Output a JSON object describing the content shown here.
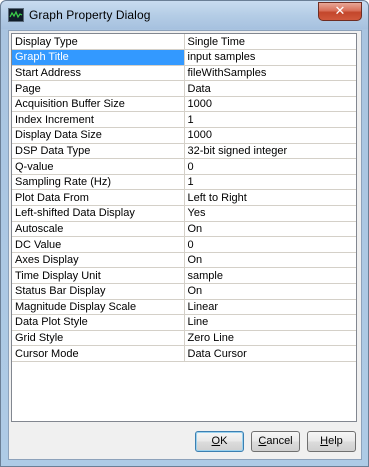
{
  "window": {
    "title": "Graph Property Dialog",
    "close_glyph": "✕"
  },
  "properties": [
    {
      "name": "Display Type",
      "value": "Single Time"
    },
    {
      "name": "Graph Title",
      "value": "input samples"
    },
    {
      "name": "Start Address",
      "value": "fileWithSamples"
    },
    {
      "name": "Page",
      "value": "Data"
    },
    {
      "name": "Acquisition Buffer Size",
      "value": "1000"
    },
    {
      "name": "Index Increment",
      "value": "1"
    },
    {
      "name": "Display Data Size",
      "value": "1000"
    },
    {
      "name": "DSP Data Type",
      "value": "32-bit signed integer"
    },
    {
      "name": "Q-value",
      "value": "0"
    },
    {
      "name": "Sampling Rate (Hz)",
      "value": "1"
    },
    {
      "name": "Plot Data From",
      "value": "Left to Right"
    },
    {
      "name": "Left-shifted Data Display",
      "value": "Yes"
    },
    {
      "name": "Autoscale",
      "value": "On"
    },
    {
      "name": "DC Value",
      "value": "0"
    },
    {
      "name": "Axes Display",
      "value": "On"
    },
    {
      "name": "Time Display Unit",
      "value": "sample"
    },
    {
      "name": "Status Bar Display",
      "value": "On"
    },
    {
      "name": "Magnitude Display Scale",
      "value": "Linear"
    },
    {
      "name": "Data Plot Style",
      "value": "Line"
    },
    {
      "name": "Grid Style",
      "value": "Zero Line"
    },
    {
      "name": "Cursor Mode",
      "value": "Data Cursor"
    }
  ],
  "selected_property": "Graph Title",
  "buttons": {
    "ok": {
      "mnemonic": "O",
      "rest": "K"
    },
    "cancel": {
      "mnemonic": "C",
      "rest": "ancel"
    },
    "help": {
      "mnemonic": "H",
      "rest": "elp"
    }
  },
  "colors": {
    "selection": "#3399ff",
    "close_button": "#c3462b"
  },
  "icons": {
    "app_icon": "graph-icon",
    "close": "close-icon"
  }
}
